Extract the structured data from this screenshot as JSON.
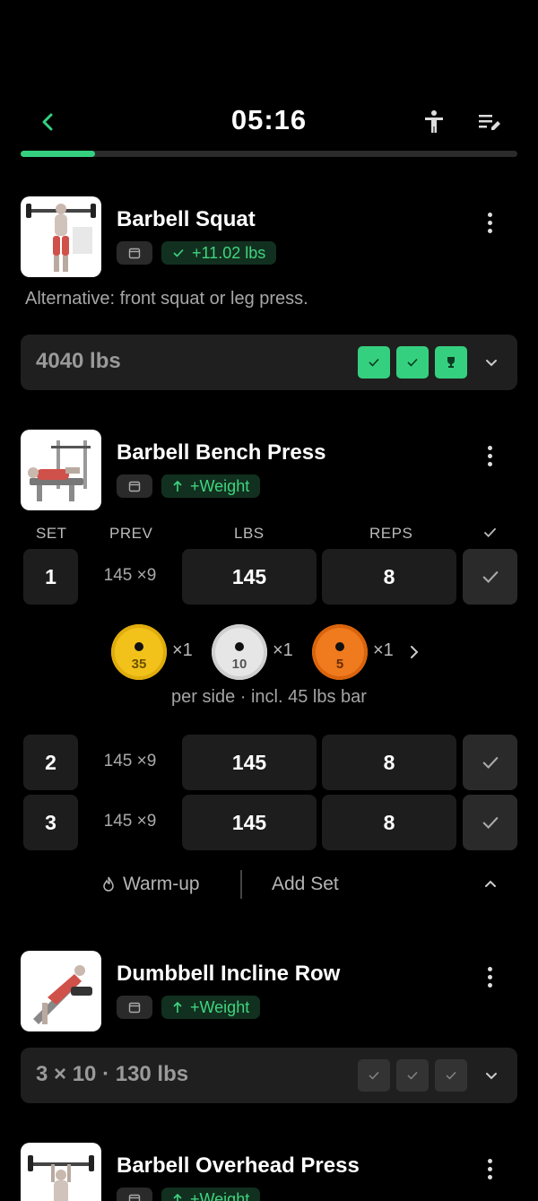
{
  "header": {
    "timer": "05:16",
    "progress": 0.15,
    "icons": [
      "back-icon",
      "body-icon",
      "edit-list-icon"
    ]
  },
  "exercises": [
    {
      "name": "Barbell Squat",
      "badge": "+11.02 lbs",
      "note": "Alternative: front squat or leg press.",
      "summary": "4040 lbs",
      "set_status": [
        "done",
        "done",
        "trophy"
      ]
    },
    {
      "name": "Barbell Bench Press",
      "badge": "+Weight",
      "columns": {
        "set": "SET",
        "prev": "PREV",
        "lbs": "LBS",
        "reps": "REPS"
      },
      "sets": [
        {
          "set": "1",
          "prev": "145 ×9",
          "lbs": "145",
          "reps": "8"
        },
        {
          "set": "2",
          "prev": "145 ×9",
          "lbs": "145",
          "reps": "8"
        },
        {
          "set": "3",
          "prev": "145 ×9",
          "lbs": "145",
          "reps": "8"
        }
      ],
      "plates": [
        {
          "weight": "35",
          "count": "×1",
          "color": "#f2c21b"
        },
        {
          "weight": "10",
          "count": "×1",
          "color": "#e6e6e6"
        },
        {
          "weight": "5",
          "count": "×1",
          "color": "#f07a1e"
        }
      ],
      "plate_caption": "per side · incl. 45 lbs bar",
      "warmup_label": "Warm-up",
      "add_set_label": "Add Set"
    },
    {
      "name": "Dumbbell Incline Row",
      "badge": "+Weight",
      "summary": "3 × 10 · 130 lbs",
      "set_status": [
        "todo",
        "todo",
        "todo"
      ]
    },
    {
      "name": "Barbell Overhead Press",
      "badge": "+Weight"
    }
  ],
  "colors": {
    "accent": "#35d07f",
    "card": "#1f1f1f",
    "background": "#000000"
  }
}
